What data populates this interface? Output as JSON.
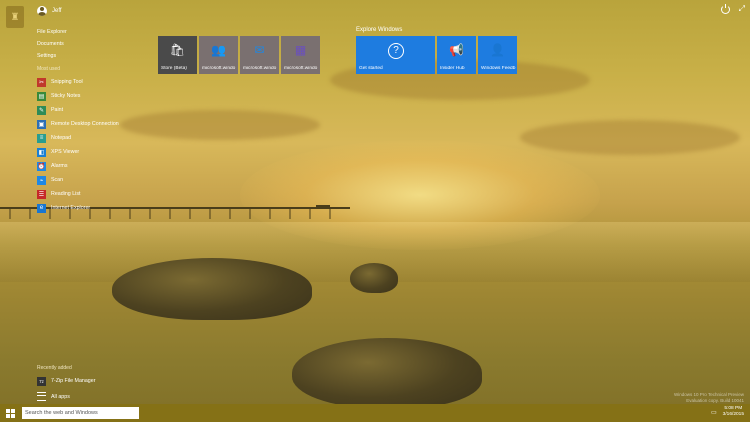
{
  "user": {
    "name": "Jeff"
  },
  "links": [
    "File Explorer",
    "Documents",
    "Settings"
  ],
  "most_used": {
    "label": "Most used",
    "items": [
      {
        "label": "Snipping Tool",
        "icon": "scissors-icon",
        "color": "#c0392b"
      },
      {
        "label": "Sticky Notes",
        "icon": "sticky-note-icon",
        "color": "#3a8a3a"
      },
      {
        "label": "Paint",
        "icon": "paint-palette-icon",
        "color": "#2e8b57"
      },
      {
        "label": "Remote Desktop Connection",
        "icon": "remote-desktop-icon",
        "color": "#2d6fb5"
      },
      {
        "label": "Notepad",
        "icon": "notepad-icon",
        "color": "#2a9d8f"
      },
      {
        "label": "XPS Viewer",
        "icon": "xps-viewer-icon",
        "color": "#1a7fd4"
      },
      {
        "label": "Alarms",
        "icon": "alarm-clock-icon",
        "color": "#1e88e5"
      },
      {
        "label": "Scan",
        "icon": "scan-icon",
        "color": "#1e88e5"
      },
      {
        "label": "Reading List",
        "icon": "reading-list-icon",
        "color": "#c62828"
      },
      {
        "label": "Internet Explorer",
        "icon": "internet-explorer-icon",
        "color": "#1976d2"
      }
    ]
  },
  "recently_added": {
    "label": "Recently added",
    "items": [
      {
        "label": "7-Zip File Manager",
        "icon": "7zip-icon"
      }
    ]
  },
  "all_apps": {
    "label": "All apps"
  },
  "tiles": [
    {
      "label": "Store (Beta)",
      "icon": "store-icon",
      "color": "#4a4a4a"
    },
    {
      "label": "microsoft.windo",
      "icon": "people-icon",
      "color": "#7a7070"
    },
    {
      "label": "microsoft.windo",
      "icon": "mail-icon",
      "color": "#7a7070"
    },
    {
      "label": "microsoft.windo",
      "icon": "calendar-icon",
      "color": "#7a7070"
    }
  ],
  "explore": {
    "title": "Explore Windows",
    "tiles": [
      {
        "label": "Get started",
        "icon": "help-icon"
      },
      {
        "label": "Insider Hub",
        "icon": "megaphone-icon"
      },
      {
        "label": "Windows Feedb",
        "icon": "feedback-icon"
      }
    ]
  },
  "search": {
    "placeholder": "Search the web and Windows"
  },
  "watermark": {
    "line1": "Windows 10 Pro Technical Preview",
    "line2": "Evaluation copy. Build 10041"
  },
  "tray": {
    "time": "5:08 PM",
    "date": "3/16/2015"
  },
  "colors": {
    "accent": "#1e7ce0",
    "taskbar": "#857116"
  }
}
